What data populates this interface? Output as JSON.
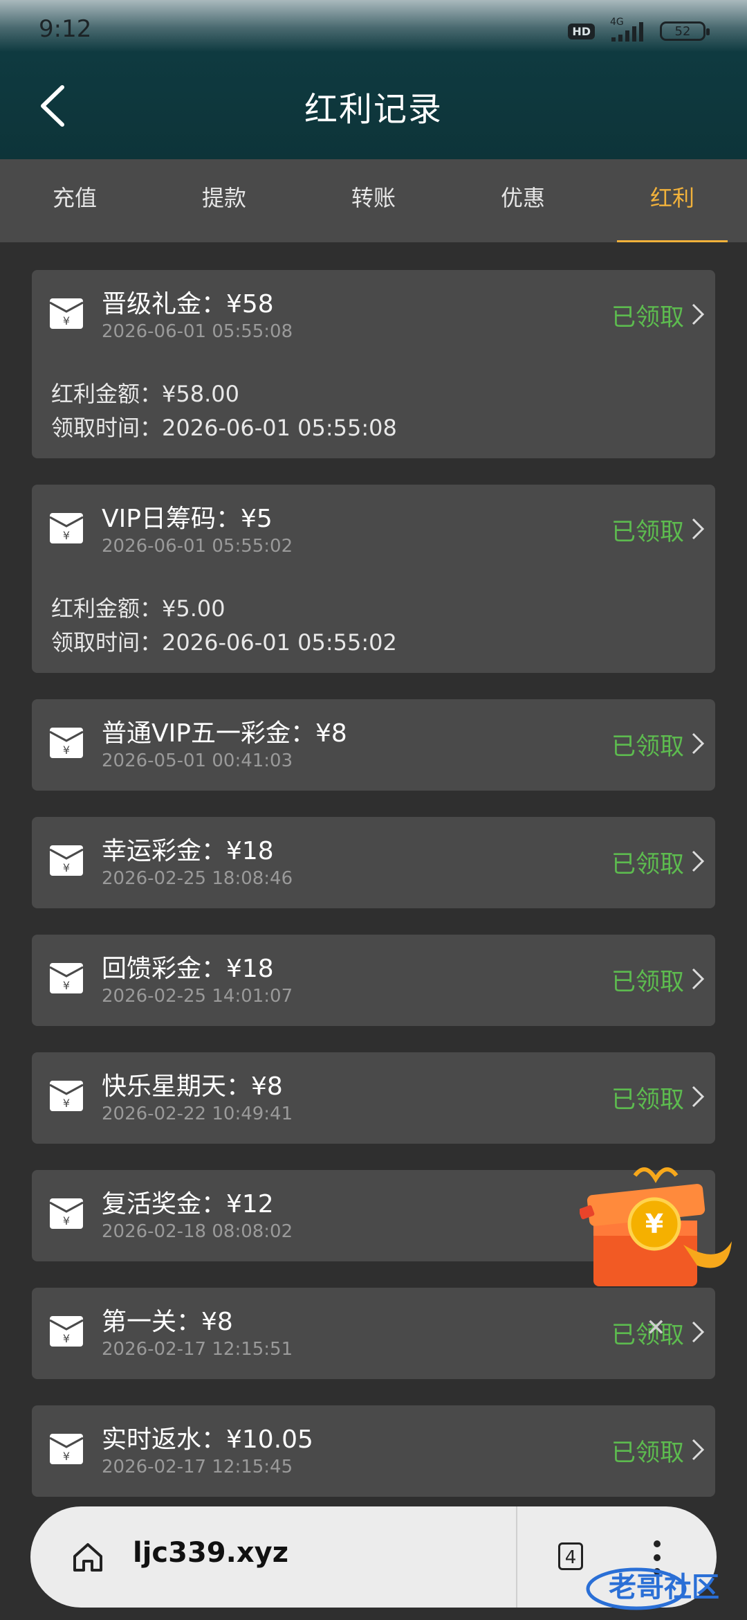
{
  "status_bar": {
    "time": "9:12",
    "hd": "HD",
    "network": "4G",
    "battery": "52"
  },
  "header": {
    "title": "红利记录"
  },
  "tabs": [
    {
      "label": "充值",
      "active": false
    },
    {
      "label": "提款",
      "active": false
    },
    {
      "label": "转账",
      "active": false
    },
    {
      "label": "优惠",
      "active": false
    },
    {
      "label": "红利",
      "active": true
    }
  ],
  "records": [
    {
      "title": "晋级礼金：¥58",
      "date": "2026-06-01 05:55:08",
      "status": "已领取",
      "amount_line": "红利金额：¥58.00",
      "time_line": "领取时间：2026-06-01 05:55:08"
    },
    {
      "title": "VIP日筹码：¥5",
      "date": "2026-06-01 05:55:02",
      "status": "已领取",
      "amount_line": "红利金额：¥5.00",
      "time_line": "领取时间：2026-06-01 05:55:02"
    },
    {
      "title": "普通VIP五一彩金：¥8",
      "date": "2026-05-01 00:41:03",
      "status": "已领取"
    },
    {
      "title": "幸运彩金：¥18",
      "date": "2026-02-25 18:08:46",
      "status": "已领取"
    },
    {
      "title": "回馈彩金：¥18",
      "date": "2026-02-25 14:01:07",
      "status": "已领取"
    },
    {
      "title": "快乐星期天：¥8",
      "date": "2026-02-22 10:49:41",
      "status": "已领取"
    },
    {
      "title": "复活奖金：¥12",
      "date": "2026-02-18 08:08:02",
      "status": ""
    },
    {
      "title": "第一关：¥8",
      "date": "2026-02-17 12:15:51",
      "status": "已领取"
    },
    {
      "title": "实时返水：¥10.05",
      "date": "2026-02-17 12:15:45",
      "status": "已领取"
    }
  ],
  "floating": {
    "gift_close": "✕"
  },
  "browser": {
    "url": "ljc339.xyz",
    "tab_count": "4"
  },
  "watermark": {
    "text": "老哥社区"
  },
  "colors": {
    "accent": "#f2b23b",
    "claimed": "#5dbb4f",
    "header": "#0d3439",
    "card": "#4a4a4a",
    "background": "#2f2f2f"
  }
}
